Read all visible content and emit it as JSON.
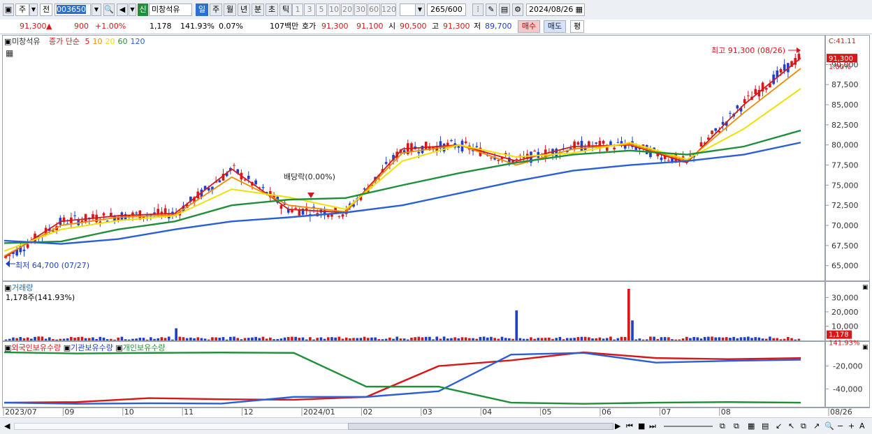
{
  "toolbar": {
    "mode_label": "주",
    "prev_label": "전",
    "code_value": "003650",
    "badge_label": "신",
    "stock_name": "미창석유",
    "period_tabs": [
      "일",
      "주",
      "월",
      "년",
      "분",
      "초",
      "틱"
    ],
    "number_tabs": [
      "1",
      "3",
      "5",
      "10",
      "20",
      "30",
      "60",
      "120"
    ],
    "count_value": "265",
    "count_total": "/600",
    "date_value": "2024/08/26"
  },
  "info": {
    "price": "91,300",
    "up_mark": "▲",
    "change": "900",
    "change_pct": "+1.00%",
    "volume": "1,178",
    "volume_ratio": "141.93%",
    "turnover": "0.07%",
    "amount": "107백만",
    "bid_label": "호가",
    "ask_price": "91,300",
    "bid_price": "91,100",
    "open_label": "시",
    "open_price": "90,500",
    "high_label": "고",
    "high_price": "91,300",
    "low_label": "저",
    "low_price": "89,700",
    "buy_button": "매수",
    "sell_button": "매도",
    "eval_button": "평"
  },
  "price_panel": {
    "stock_label": "미창석유",
    "ma_label": "종가 단순",
    "ma_periods": [
      "5",
      "10",
      "20",
      "60",
      "120"
    ],
    "ma_colors": [
      "#d81818",
      "#f08a00",
      "#f0e000",
      "#1f8f3a",
      "#2a5fd8"
    ],
    "high_annot": "최고 91,300 (08/26)",
    "low_annot": "최저 64,700 (07/27)",
    "div_annot": "배당락(0.00%)",
    "last_tag": "91,300",
    "pct_tag": "1.00%",
    "corner_label": "C:41.11"
  },
  "volume_panel": {
    "title": "거래량",
    "sub": "1,178주(141.93%)",
    "last_tag": "1,178",
    "pct_tag": "141.93%"
  },
  "holders_panel": {
    "labels": [
      "외국인보유수량",
      "기관보유수량",
      "개인보유수량"
    ],
    "colors": [
      "#d81818",
      "#2a5fd8",
      "#1f8f3a"
    ]
  },
  "x_axis": [
    "2023/07",
    "09",
    "10",
    "11",
    "12",
    "2024/01",
    "02",
    "03",
    "04",
    "05",
    "06",
    "07",
    "08",
    "08/26"
  ],
  "chart_data": [
    {
      "type": "line",
      "title": "미창석유",
      "ylim": [
        63500,
        93500
      ],
      "yticks": [
        65000,
        67500,
        70000,
        72500,
        75000,
        77500,
        80000,
        82500,
        85000,
        87500,
        90000
      ],
      "x": [
        "2023/07",
        "08",
        "09",
        "10",
        "11",
        "12",
        "2024/01",
        "02",
        "03",
        "04",
        "05",
        "06",
        "07",
        "08",
        "08/26"
      ],
      "series": [
        {
          "name": "5",
          "values": [
            66000,
            70500,
            71200,
            71500,
            77000,
            72000,
            71600,
            79500,
            80000,
            78000,
            79800,
            80000,
            77800,
            85000,
            90800
          ]
        },
        {
          "name": "10",
          "values": [
            66200,
            70000,
            71000,
            71300,
            76000,
            72500,
            71700,
            79000,
            80000,
            77500,
            79500,
            80100,
            78000,
            84000,
            89500
          ]
        },
        {
          "name": "20",
          "values": [
            66800,
            69500,
            70600,
            71200,
            74500,
            73500,
            72000,
            78000,
            80000,
            78500,
            79000,
            80300,
            78200,
            82000,
            87000
          ]
        },
        {
          "name": "60",
          "values": [
            67800,
            68000,
            69500,
            70500,
            72500,
            73200,
            73400,
            75000,
            76500,
            77800,
            78800,
            79300,
            78800,
            79800,
            81800
          ]
        },
        {
          "name": "120",
          "values": [
            68100,
            67700,
            68300,
            69500,
            70500,
            71000,
            71600,
            72500,
            74000,
            75500,
            76800,
            77500,
            78000,
            78800,
            80300
          ]
        }
      ],
      "annotations": [
        "최고 91,300 (08/26)",
        "최저 64,700 (07/27)",
        "배당락(0.00%)"
      ]
    },
    {
      "type": "bar",
      "title": "거래량",
      "yticks": [
        10000,
        20000,
        30000
      ],
      "ylim": [
        0,
        36000
      ],
      "last_value": 1178,
      "spikes": [
        {
          "x": "10",
          "value": 8500
        },
        {
          "x": "04",
          "value": 21000
        },
        {
          "x": "06",
          "value": 36000
        },
        {
          "x": "06",
          "value": 14000
        },
        {
          "x": "08/26",
          "value": 1178
        }
      ]
    },
    {
      "type": "line",
      "yticks": [
        -20000,
        -40000
      ],
      "ylim": [
        -55000,
        -5000
      ],
      "x": [
        "2023/07",
        "09",
        "11",
        "2024/01",
        "02",
        "03",
        "04",
        "05",
        "06",
        "07",
        "08",
        "08/26"
      ],
      "series": [
        {
          "name": "외국인보유수량",
          "values": [
            -52000,
            -51500,
            -48000,
            -49000,
            -49500,
            -47000,
            -20000,
            -15000,
            -8000,
            -13000,
            -14000,
            -13000
          ]
        },
        {
          "name": "기관보유수량",
          "values": [
            -52000,
            -53000,
            -52500,
            -52800,
            -47000,
            -47000,
            -42000,
            -10000,
            -8500,
            -17000,
            -15500,
            -14500
          ]
        },
        {
          "name": "개인보유수량",
          "values": [
            -8000,
            -9000,
            -8500,
            -8200,
            -8500,
            -38000,
            -38000,
            -52000,
            -53000,
            -52000,
            -51500,
            -52000
          ]
        }
      ]
    }
  ]
}
